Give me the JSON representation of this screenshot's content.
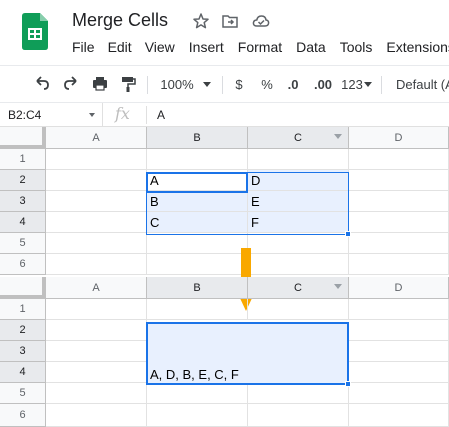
{
  "app": {
    "doc_title": "Merge Cells",
    "brand_color": "#0f9d58",
    "title_icons": [
      "star-icon",
      "move-to-folder-icon",
      "cloud-status-icon"
    ],
    "menu": [
      "File",
      "Edit",
      "View",
      "Insert",
      "Format",
      "Data",
      "Tools",
      "Extensions"
    ]
  },
  "toolbar": {
    "zoom": "100%",
    "currency": "$",
    "percent": "%",
    "decrease_decimals": ".0",
    "increase_decimals": ".00",
    "more_formats": "123",
    "font": "Default (Ar",
    "icons": [
      "undo-icon",
      "redo-icon",
      "print-icon",
      "paint-format-icon"
    ]
  },
  "formula_bar": {
    "name_box": "B2:C4",
    "fx": "fx",
    "content": "A"
  },
  "sheet_before": {
    "columns": [
      "A",
      "B",
      "C",
      "D"
    ],
    "rows": [
      "1",
      "2",
      "3",
      "4",
      "5",
      "6"
    ],
    "cells": {
      "B2": "A",
      "C2": "D",
      "B3": "B",
      "C3": "E",
      "B4": "C",
      "C4": "F"
    }
  },
  "sheet_after": {
    "columns": [
      "A",
      "B",
      "C",
      "D"
    ],
    "rows": [
      "1",
      "2",
      "3",
      "4",
      "5",
      "6"
    ],
    "merged_value": "A, D, B, E, C, F"
  },
  "accent_color": "#1a73e8",
  "arrow_color": "#f9a800"
}
